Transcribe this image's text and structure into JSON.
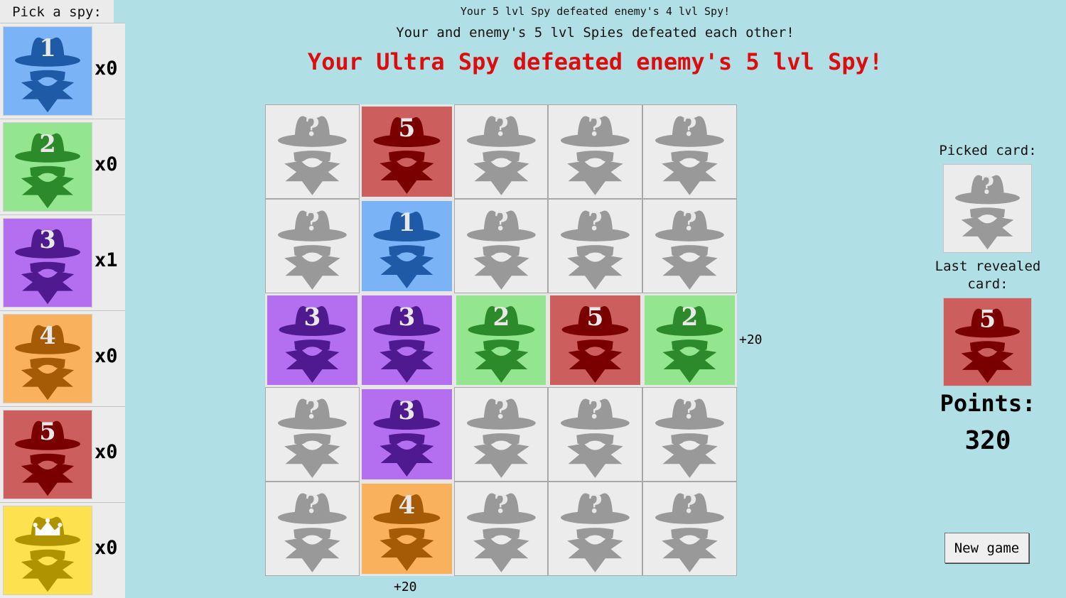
{
  "sidebar": {
    "title": "Pick a spy:",
    "spies": [
      {
        "label": "1",
        "count": "x0",
        "bg": "#7bb3f7",
        "fg": "#1f5aa6",
        "crown": false
      },
      {
        "label": "2",
        "count": "x0",
        "bg": "#93e68f",
        "fg": "#2c8a2a",
        "crown": false
      },
      {
        "label": "3",
        "count": "x1",
        "bg": "#b36ff0",
        "fg": "#4f1a8f",
        "crown": false
      },
      {
        "label": "4",
        "count": "x0",
        "bg": "#f9b15d",
        "fg": "#a55a06",
        "crown": false
      },
      {
        "label": "5",
        "count": "x0",
        "bg": "#cc5e5e",
        "fg": "#7a0000",
        "crown": false
      },
      {
        "label": "",
        "count": "x0",
        "bg": "#fde14f",
        "fg": "#b09300",
        "crown": true
      }
    ]
  },
  "messages": {
    "line1": "Your 5 lvl Spy defeated enemy's 4 lvl Spy!",
    "line2": "Your and enemy's 5 lvl Spies defeated each other!",
    "line3": "Your Ultra Spy defeated enemy's 5 lvl Spy!"
  },
  "board": {
    "cells": [
      [
        "?",
        "5",
        "?",
        "?",
        "?"
      ],
      [
        "?",
        "1",
        "?",
        "?",
        "?"
      ],
      [
        "3",
        "3",
        "2",
        "5",
        "2"
      ],
      [
        "?",
        "3",
        "?",
        "?",
        "?"
      ],
      [
        "?",
        "4",
        "?",
        "?",
        "?"
      ]
    ],
    "row_bonus": "+20",
    "col_bonus": "+20"
  },
  "card_colors": {
    "?": {
      "bg": "#ececec",
      "fg": "#999999"
    },
    "1": {
      "bg": "#7bb3f7",
      "fg": "#1f5aa6"
    },
    "2": {
      "bg": "#93e68f",
      "fg": "#2c8a2a"
    },
    "3": {
      "bg": "#b36ff0",
      "fg": "#4f1a8f"
    },
    "4": {
      "bg": "#f9b15d",
      "fg": "#a55a06"
    },
    "5": {
      "bg": "#cc5e5e",
      "fg": "#7a0000"
    }
  },
  "side": {
    "picked_label": "Picked card:",
    "picked_card": "?",
    "last_label": "Last revealed card:",
    "last_card": "5",
    "points_label": "Points:",
    "points_value": "320",
    "new_game_label": "New game"
  }
}
